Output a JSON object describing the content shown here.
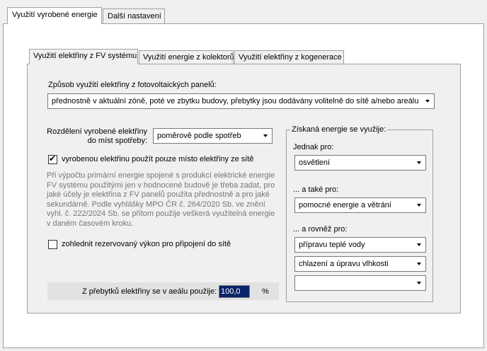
{
  "outer_tabs": [
    {
      "label": "Využití vyrobené energie",
      "active": true
    },
    {
      "label": "Další nastavení",
      "active": false
    }
  ],
  "inner_tabs": [
    {
      "label": "Využití elektřiny z FV systému",
      "active": true
    },
    {
      "label": "Využití energie z kolektorů",
      "active": false
    },
    {
      "label": "Využití elektřiny z kogenerace",
      "active": false
    }
  ],
  "usage_mode": {
    "label": "Způsob využití elektřiny z fotovoltaických panelů:",
    "value": "přednostně v aktuální zóně, poté ve zbytku budovy, přebytky jsou dodávány volitelně do sítě a/nebo areálu"
  },
  "distribution": {
    "label_line1": "Rozdělení vyrobené elektřiny",
    "label_line2": "do míst spotřeby:",
    "value": "poměrově podle spotřeb"
  },
  "replace_checkbox": {
    "label": "vyrobenou elektřinu použít pouze místo elektřiny ze sítě",
    "checked": true
  },
  "note_lines": [
    "Při výpočtu primární energie spojené s produkcí elektrické energie",
    "FV systému použitými jen v hodnocené budově je třeba zadat, pro",
    "jaké účely je elektřina z FV panelů použita přednostně a pro jaké",
    "sekundárně. Podle vyhlášky MPO ČR č. 264/2020 Sb. ve znění",
    "vyhl. č. 222/2024 Sb. se přitom použije veškerá využitelná energie",
    "v daném časovém kroku."
  ],
  "reserve_checkbox": {
    "label": "zohlednit rezervovaný výkon pro připojení do sítě",
    "checked": false
  },
  "surplus": {
    "label": "Z přebytků elektřiny se v aeálu použije:",
    "value": "100,0",
    "unit": "%"
  },
  "energy_group": {
    "title": "Získaná energie se využije:",
    "primary_label": "Jednak pro:",
    "primary_value": "osvětlení",
    "secondary_label": "... a také pro:",
    "secondary_value": "pomocné energie a větrání",
    "tertiary_label": "... a rovněž pro:",
    "tertiary_values": [
      "přípravu teplé vody",
      "chlazení a úpravu vlhkosti",
      ""
    ]
  }
}
